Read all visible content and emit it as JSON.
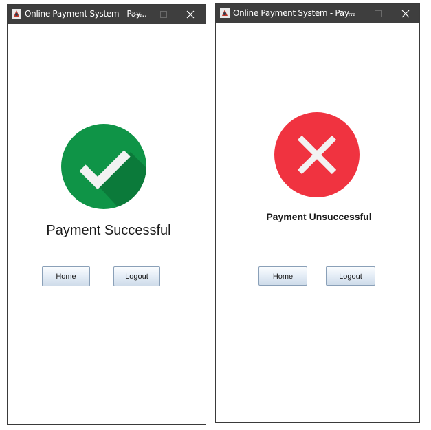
{
  "windows": [
    {
      "title": "Online Payment System - Pay...",
      "status_text": "Payment Successful",
      "buttons": {
        "home": "Home",
        "logout": "Logout"
      },
      "icon": "checkmark-circle-icon",
      "accent": "#0f9447"
    },
    {
      "title": "Online Payment System - Pay...",
      "status_text": "Payment Unsuccessful",
      "buttons": {
        "home": "Home",
        "logout": "Logout"
      },
      "icon": "x-circle-icon",
      "accent": "#f03340"
    }
  ],
  "colors": {
    "titlebar": "#3e3e3e",
    "success_green": "#0f9447",
    "error_red": "#f03340"
  }
}
